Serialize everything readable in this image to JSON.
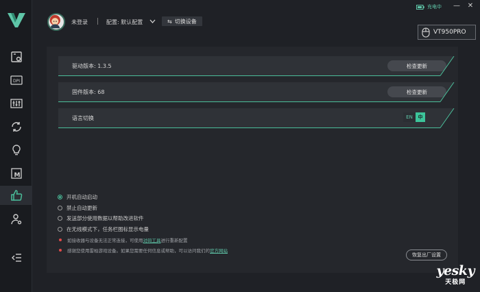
{
  "header": {
    "login_status": "未登录",
    "config_label": "配置: 默认配置",
    "switch_device": "切换设备",
    "charging": "充电中",
    "device_name": "VT950PRO"
  },
  "rows": {
    "driver": {
      "label": "驱动版本: 1.3.5",
      "button": "检查更新"
    },
    "firmware": {
      "label": "固件版本: 68",
      "button": "检查更新"
    },
    "language": {
      "label": "语言切换",
      "en": "EN",
      "zh": "中"
    }
  },
  "options": [
    {
      "label": "开机自动启动",
      "selected": true
    },
    {
      "label": "禁止自动更新",
      "selected": false
    },
    {
      "label": "发送部分使用数据以帮助改进软件",
      "selected": false
    },
    {
      "label": "在无线模式下，任务栏图标显示电量",
      "selected": false
    }
  ],
  "notes": {
    "note1_before": "如接收器与设备无法正常连接，可使用",
    "note1_link": "对码工具",
    "note1_after": "进行重新配置",
    "note2_before": "感谢您使用雷柏游戏设备。如果您需要任何信息或帮助，可以访问我们的",
    "note2_link": "官方网站"
  },
  "reset_button": "恢复出厂设置",
  "watermark": {
    "big": "yesky",
    "small": "天极网"
  },
  "colors": {
    "accent": "#4bbf9b",
    "background": "#1f2126",
    "panel": "#25272c"
  },
  "icons": [
    "logo-v-icon",
    "mouse-settings-icon",
    "dpi-icon",
    "equalizer-icon",
    "sync-icon",
    "lightbulb-icon",
    "macro-icon",
    "thumbs-up-icon",
    "user-settings-icon",
    "collapse-menu-icon"
  ]
}
